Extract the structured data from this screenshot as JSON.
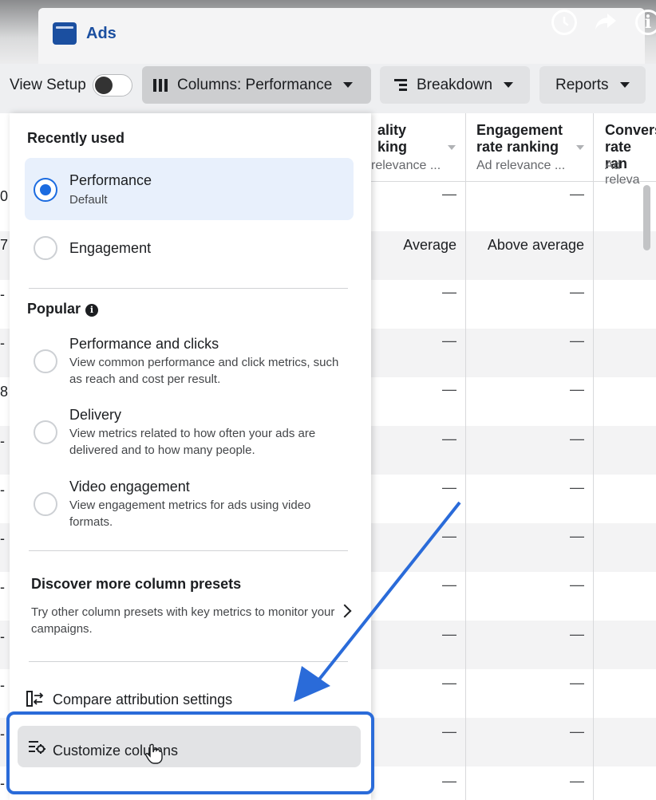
{
  "topbar": {
    "tab_title": "Ads",
    "icons": [
      "clock-icon",
      "share-icon",
      "info-icon"
    ]
  },
  "toolbar": {
    "view_setup_label": "View Setup",
    "columns_label": "Columns: Performance",
    "breakdown_label": "Breakdown",
    "reports_label": "Reports"
  },
  "table": {
    "headers": [
      {
        "title_line1": "ality",
        "title_line2": "king",
        "subtitle": "relevance ..."
      },
      {
        "title_line1": "Engagement",
        "title_line2": "rate ranking",
        "subtitle": "Ad relevance ..."
      },
      {
        "title_line1": "Convers",
        "title_line2": "rate ran",
        "subtitle": "Ad releva"
      }
    ],
    "edge_values": [
      "0",
      "7",
      "-",
      "-",
      "8",
      "-",
      "-",
      "-",
      "-",
      "-",
      "-",
      "-",
      "-"
    ],
    "row_quality": [
      "—",
      "Average",
      "—",
      "—",
      "—",
      "—",
      "—",
      "—",
      "—",
      "—",
      "—",
      "—",
      "—"
    ],
    "row_engagement": [
      "—",
      "Above average",
      "—",
      "—",
      "—",
      "—",
      "—",
      "—",
      "—",
      "—",
      "—",
      "—",
      "—"
    ]
  },
  "menu": {
    "recently_used_title": "Recently used",
    "performance_label": "Performance",
    "performance_desc": "Default",
    "engagement_label": "Engagement",
    "popular_title": "Popular",
    "perf_clicks_label": "Performance and clicks",
    "perf_clicks_desc": "View common performance and click metrics, such as reach and cost per result.",
    "delivery_label": "Delivery",
    "delivery_desc": "View metrics related to how often your ads are delivered and to how many people.",
    "video_label": "Video engagement",
    "video_desc": "View engagement metrics for ads using video formats.",
    "discover_title": "Discover more column presets",
    "discover_desc": "Try other column presets with key metrics to monitor your campaigns.",
    "compare_label": "Compare attribution settings",
    "customize_label": "Customize columns"
  },
  "colors": {
    "accent": "#1b6be0",
    "highlight_box": "#2a6bd9",
    "selected_bg": "#e8f0fc"
  }
}
